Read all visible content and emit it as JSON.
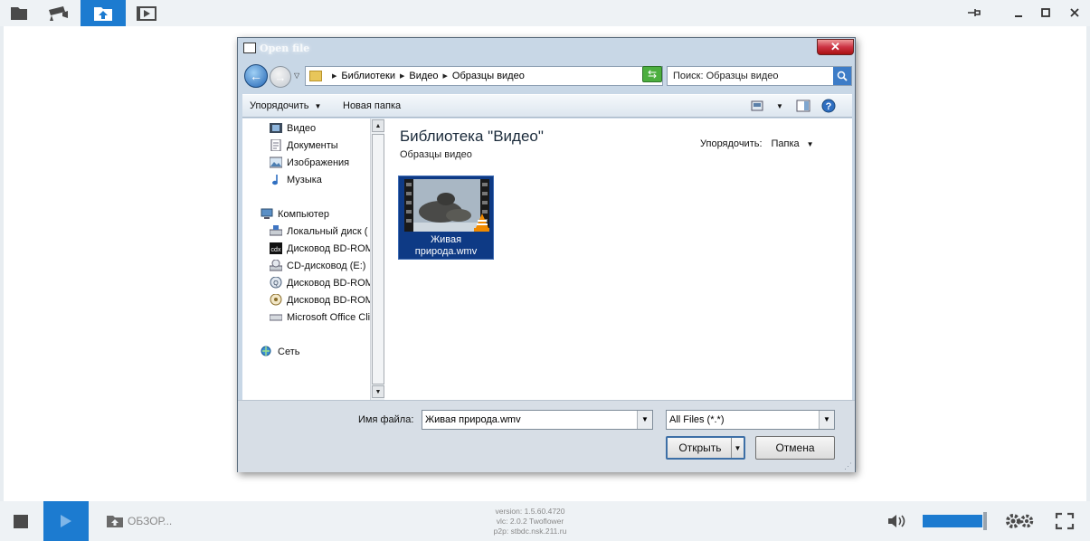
{
  "player": {
    "version": "version: 1.5.60.4720",
    "vlc": "vlc: 2.0.2 Twoflower",
    "p2p": "p2p: stbdc.nsk.211.ru",
    "browse_label": "ОБЗОР...",
    "volume_level": 0.75,
    "accent_color": "#1c7bd0"
  },
  "dialog": {
    "title": "Open file",
    "breadcrumbs": [
      "Библиотеки",
      "Видео",
      "Образцы видео"
    ],
    "search_placeholder": "Поиск: Образцы видео",
    "toolbar": {
      "organize": "Упорядочить",
      "new_folder": "Новая папка"
    },
    "nav_tree": {
      "libraries": [
        {
          "label": "Видео",
          "icon": "video-library-icon"
        },
        {
          "label": "Документы",
          "icon": "documents-icon"
        },
        {
          "label": "Изображения",
          "icon": "images-icon"
        },
        {
          "label": "Музыка",
          "icon": "music-icon"
        }
      ],
      "computer": "Компьютер",
      "drives": [
        {
          "label": "Локальный диск (",
          "icon": "hard-disk-icon"
        },
        {
          "label": "Дисковод BD-ROM",
          "icon": "bd-rom-icon"
        },
        {
          "label": "CD-дисковод (E:)",
          "icon": "cd-drive-icon"
        },
        {
          "label": "Дисковод BD-ROM",
          "icon": "bd-rom-icon"
        },
        {
          "label": "Дисковод BD-ROM",
          "icon": "bd-rom-icon"
        },
        {
          "label": "Microsoft Office Cli",
          "icon": "removable-drive-icon"
        }
      ],
      "network": "Сеть"
    },
    "library": {
      "title": "Библиотека \"Видео\"",
      "subtitle": "Образцы видео",
      "arrange_label": "Упорядочить:",
      "arrange_value": "Папка"
    },
    "files": [
      {
        "name_line1": "Живая",
        "name_line2": "природа.wmv"
      }
    ],
    "filename_label": "Имя файла:",
    "filename_value": "Живая природа.wmv",
    "filter_value": "All Files (*.*)",
    "open_button": "Открыть",
    "cancel_button": "Отмена"
  }
}
